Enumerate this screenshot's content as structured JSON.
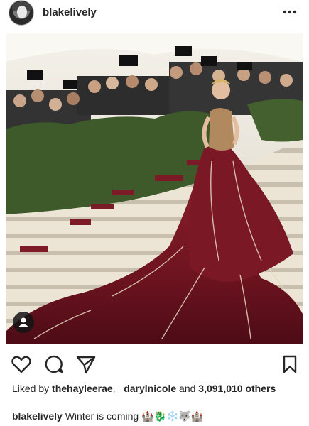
{
  "post": {
    "username": "blakelively",
    "likes": {
      "prefix": "Liked by",
      "user1": "thehayleerae",
      "separator": ",",
      "user2": "_darylnicole",
      "and_text": "and",
      "count": "3,091,010",
      "others": "others"
    },
    "caption": {
      "username": "blakelively",
      "text": "Winter is coming",
      "emojis": "🏰🐉❄️🐺🏰"
    }
  },
  "icons": {
    "more": "more-options-icon",
    "like": "heart-icon",
    "comment": "comment-icon",
    "share": "send-icon",
    "save": "bookmark-icon",
    "tag": "user-tag-icon"
  },
  "colors": {
    "text": "#262626",
    "gown": "#6e1420",
    "hedge": "#3f5a2a",
    "stairs": "#e9e1d3"
  }
}
